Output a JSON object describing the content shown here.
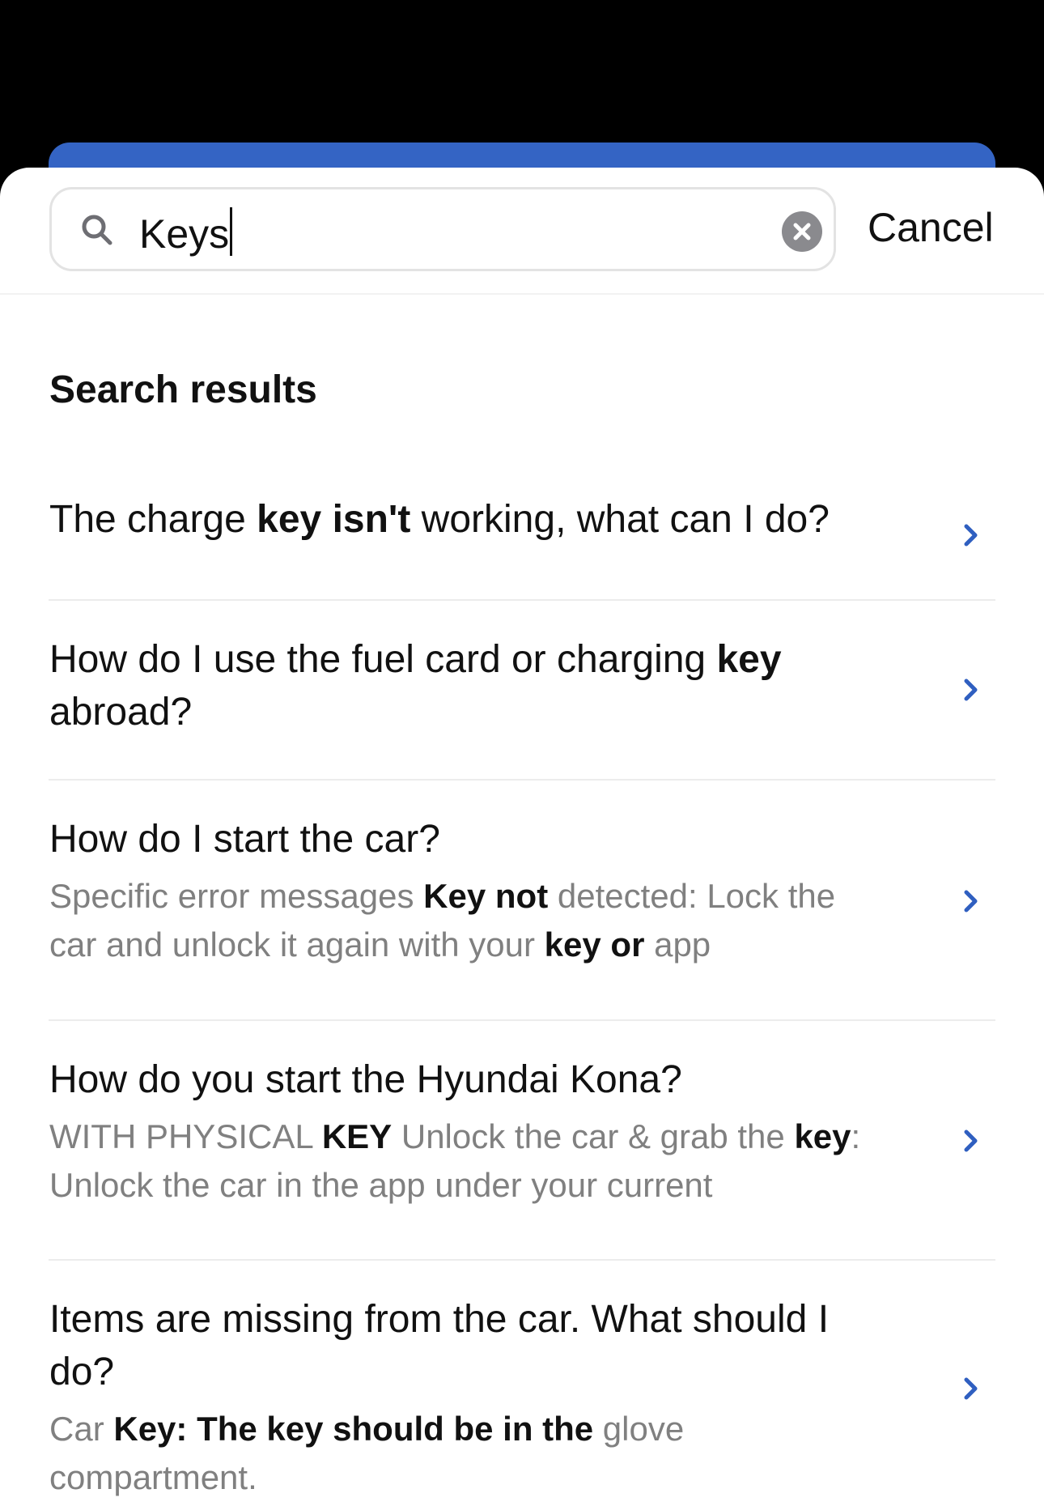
{
  "colors": {
    "accent": "#3464c4",
    "chevron": "#2f5fc0",
    "clear_button": "#8a8a8e",
    "snippet_text": "#808080"
  },
  "search": {
    "icon": "search-icon",
    "value": "Keys",
    "clear_icon": "close-icon",
    "cancel_label": "Cancel"
  },
  "section": {
    "title": "Search results"
  },
  "results": [
    {
      "title": [
        {
          "text": "The charge ",
          "bold": false
        },
        {
          "text": "key isn't",
          "bold": true
        },
        {
          "text": " working, what can I do?",
          "bold": false
        }
      ],
      "snippet": [],
      "chevron_icon": "chevron-right-icon"
    },
    {
      "title": [
        {
          "text": "How do I use the fuel card or charging ",
          "bold": false
        },
        {
          "text": "key",
          "bold": true
        },
        {
          "text": " abroad?",
          "bold": false
        }
      ],
      "snippet": [],
      "chevron_icon": "chevron-right-icon"
    },
    {
      "title": [
        {
          "text": "How do I start the car?",
          "bold": false
        }
      ],
      "snippet": [
        {
          "text": "Specific error messages ",
          "bold": false
        },
        {
          "text": "Key not",
          "bold": true
        },
        {
          "text": " detected: Lock the car and unlock it again with your ",
          "bold": false
        },
        {
          "text": "key or",
          "bold": true
        },
        {
          "text": " app",
          "bold": false
        }
      ],
      "chevron_icon": "chevron-right-icon"
    },
    {
      "title": [
        {
          "text": "How do you start the Hyundai Kona?",
          "bold": false
        }
      ],
      "snippet": [
        {
          "text": "WITH PHYSICAL ",
          "bold": false
        },
        {
          "text": "KEY",
          "bold": true
        },
        {
          "text": " Unlock the car & grab the ",
          "bold": false
        },
        {
          "text": "key",
          "bold": true
        },
        {
          "text": ": Unlock the car in the app under your current",
          "bold": false
        }
      ],
      "chevron_icon": "chevron-right-icon"
    },
    {
      "title": [
        {
          "text": "Items are missing from the car. What should I do?",
          "bold": false
        }
      ],
      "snippet": [
        {
          "text": "Car ",
          "bold": false
        },
        {
          "text": "Key: The key should be in the",
          "bold": true
        },
        {
          "text": " glove compartment.",
          "bold": false
        }
      ],
      "chevron_icon": "chevron-right-icon"
    }
  ]
}
